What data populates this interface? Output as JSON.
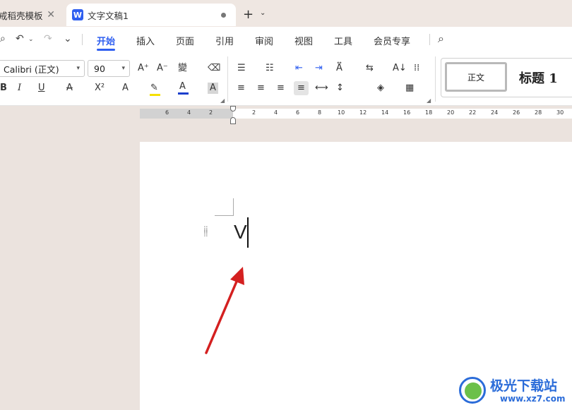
{
  "tabs": [
    {
      "label": "戒稻壳模板",
      "close": "✕"
    },
    {
      "label": "文字文稿1",
      "logo": "W"
    }
  ],
  "new_tab": {
    "plus": "+",
    "chevron": "⌄"
  },
  "quick_access": {
    "undo": "↶",
    "redo": "↷",
    "more": "⌄"
  },
  "menu": [
    "开始",
    "插入",
    "页面",
    "引用",
    "审阅",
    "视图",
    "工具",
    "会员专享"
  ],
  "active_menu": "开始",
  "font": {
    "name": "Calibri (正文)",
    "size": "90"
  },
  "ribbon_glyphs": {
    "grow": "A⁺",
    "shrink": "A⁻",
    "phonetic": "變",
    "eraser": "⌫",
    "bold": "B",
    "italic": "I",
    "underline": "U",
    "strike": "A",
    "superscript": "X²",
    "effects": "A",
    "highlight": "✎",
    "color": "A",
    "shade": "A",
    "bullets": "☰",
    "numbering": "☷",
    "outdent": "⇤",
    "indent": "⇥",
    "align_left": "≡",
    "align_center": "≡",
    "align_right": "≡",
    "justify": "≡",
    "linespacing": "↕"
  },
  "styles": {
    "normal": "正文",
    "heading1": "标题 1"
  },
  "ruler_ticks": [
    "6",
    "4",
    "2",
    "2",
    "4",
    "6",
    "8",
    "10",
    "12",
    "14",
    "16",
    "18",
    "20",
    "22",
    "24",
    "26",
    "28",
    "30"
  ],
  "document": {
    "text": "V"
  },
  "watermark": {
    "name": "极光下载站",
    "url": "www.xz7.com"
  },
  "colors": {
    "accent": "#2f5ff0",
    "arrow": "#d42020",
    "font_color_bar": "#1c3fcc",
    "highlight_bar": "#f5e000"
  }
}
